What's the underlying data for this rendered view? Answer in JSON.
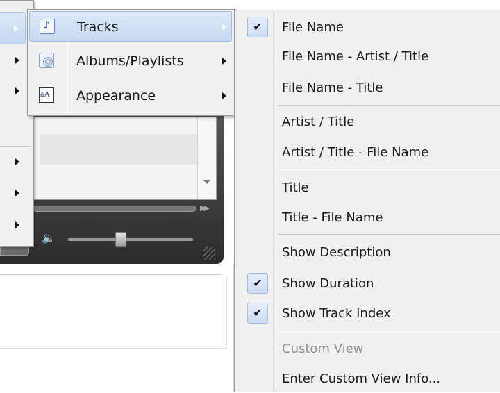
{
  "view_menu": {
    "items": [
      {
        "label": "Tracks",
        "icon": "music-note-icon",
        "selected": true
      },
      {
        "label": "Albums/Playlists",
        "icon": "album-disc-icon",
        "selected": false
      },
      {
        "label": "Appearance",
        "icon": "font-icon",
        "selected": false
      }
    ]
  },
  "tracks_menu": {
    "items": [
      {
        "label": "File Name",
        "checked": true
      },
      {
        "label": "File Name - Artist / Title",
        "checked": false
      },
      {
        "label": "File Name - Title",
        "checked": false
      },
      {
        "label": "Artist / Title",
        "checked": false
      },
      {
        "label": "Artist / Title - File Name",
        "checked": false
      },
      {
        "label": "Title",
        "checked": false
      },
      {
        "label": "Title - File Name",
        "checked": false
      },
      {
        "label": "Show Description",
        "checked": false
      },
      {
        "label": "Show Duration",
        "checked": true
      },
      {
        "label": "Show Track Index",
        "checked": true
      },
      {
        "label": "Custom View",
        "checked": false,
        "disabled": true
      },
      {
        "label": "Enter Custom View Info...",
        "checked": false
      }
    ],
    "check_glyph": "✔"
  }
}
